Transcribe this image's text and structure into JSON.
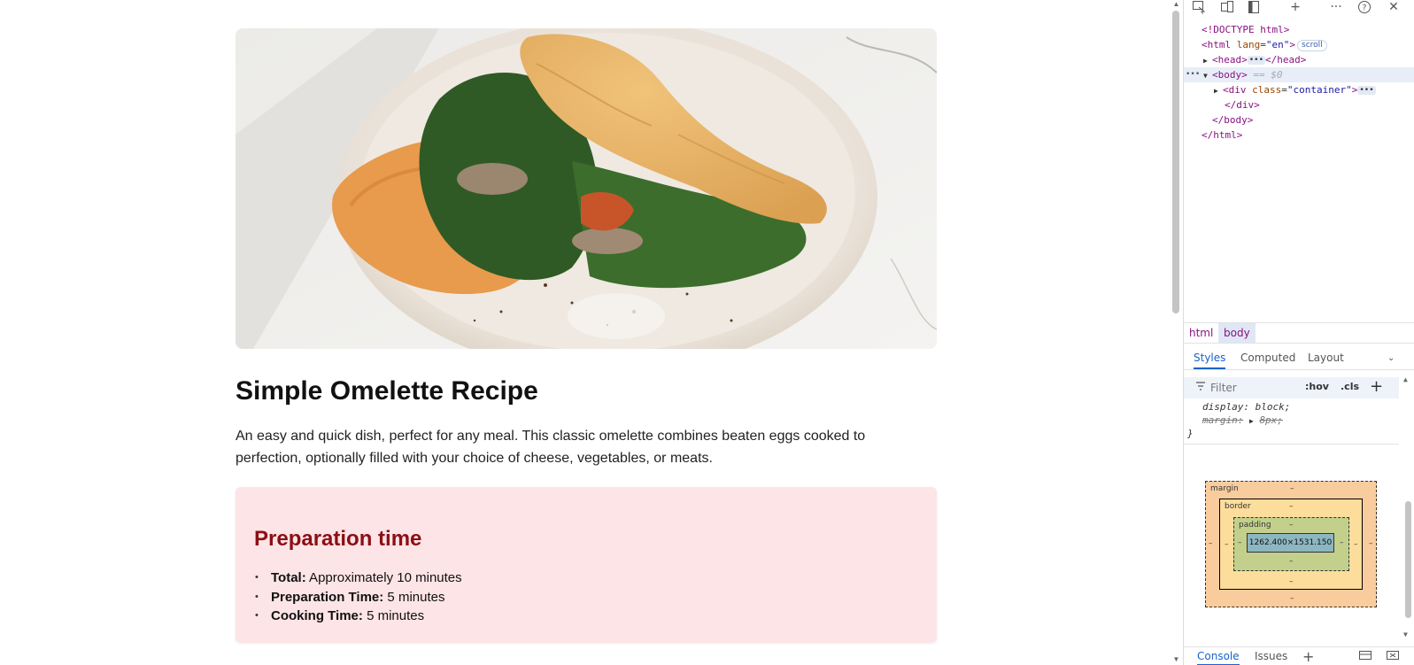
{
  "page": {
    "hero_image_alt": "",
    "title": "Simple Omelette Recipe",
    "description": "An easy and quick dish, perfect for any meal. This classic omelette combines beaten eggs cooked to perfection, optionally filled with your choice of cheese, vegetables, or meats.",
    "prep": {
      "heading": "Preparation time",
      "items": [
        {
          "label": "Total:",
          "value": " Approximately 10 minutes"
        },
        {
          "label": "Preparation Time:",
          "value": " 5 minutes"
        },
        {
          "label": "Cooking Time:",
          "value": " 5 minutes"
        }
      ]
    }
  },
  "devtools": {
    "toolbar_icons": [
      "inspect-icon",
      "device-toolbar-icon",
      "dock-icon",
      "new-tab-icon",
      "more-icon",
      "help-icon",
      "close-icon"
    ],
    "dom": {
      "doctype": "<!DOCTYPE html>",
      "html_open_tag": "<html ",
      "html_attr": "lang",
      "html_attr_val": "\"en\"",
      "html_close_bracket": ">",
      "scroll_badge": "scroll",
      "head_open": "<head>",
      "head_close": "</head>",
      "body_open": "<body>",
      "body_marker": "== $0",
      "div_open": "<div ",
      "div_attr": "class",
      "div_attr_val": "\"container\"",
      "div_close_bracket": ">",
      "div_close": "</div>",
      "body_close": "</body>",
      "html_close": "</html>",
      "ellipsis": "•••"
    },
    "breadcrumbs": [
      "html",
      "body"
    ],
    "style_tabs": [
      "Styles",
      "Computed",
      "Layout"
    ],
    "filter": {
      "placeholder": "Filter",
      "hov": ":hov",
      "cls": ".cls"
    },
    "styles": {
      "line1_prop": "display",
      "line1_val": "block;",
      "line2_prop": "margin:",
      "line2_val": "8px;",
      "closing_brace": "}"
    },
    "box_model": {
      "margin_label": "margin",
      "border_label": "border",
      "padding_label": "padding",
      "content_size": "1262.400×1531.150",
      "dash": "–"
    },
    "drawer_tabs": [
      "Console",
      "Issues"
    ]
  },
  "colors": {
    "title": "#111111",
    "prep_bg": "#fde4e6",
    "prep_heading": "#8b0f14",
    "devtools_accent": "#1a63c8",
    "dom_tag": "#881280"
  }
}
